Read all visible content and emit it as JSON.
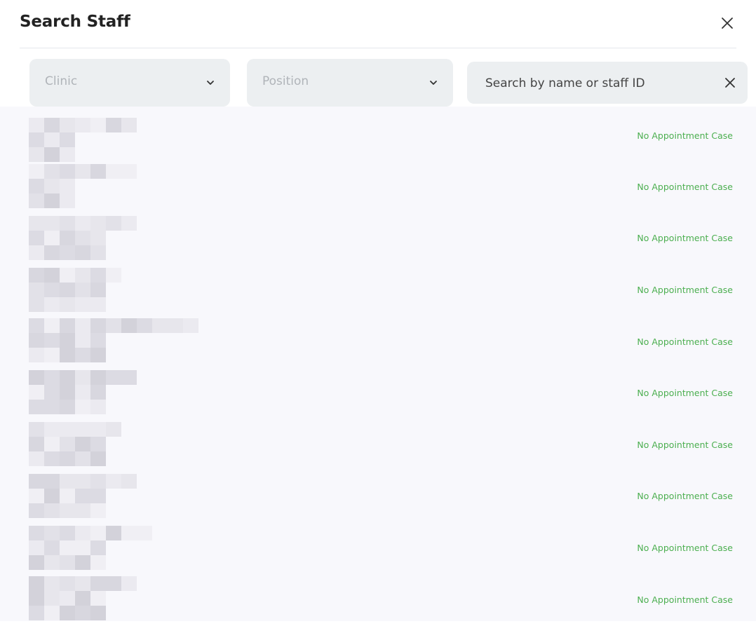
{
  "header": {
    "title": "Search Staff",
    "close_icon": "close-icon"
  },
  "filters": {
    "clinic_placeholder": "Clinic",
    "position_placeholder": "Position",
    "search_placeholder": "Search by name or staff ID",
    "search_value": ""
  },
  "colors": {
    "status_green": "#4caf50",
    "field_bg": "#eceff1",
    "list_bg": "#f8f8fc"
  },
  "staff": [
    {
      "status": "No Appointment Case"
    },
    {
      "status": "No Appointment Case"
    },
    {
      "status": "No Appointment Case"
    },
    {
      "status": "No Appointment Case"
    },
    {
      "status": "No Appointment Case"
    },
    {
      "status": "No Appointment Case"
    },
    {
      "status": "No Appointment Case"
    },
    {
      "status": "No Appointment Case"
    },
    {
      "status": "No Appointment Case"
    },
    {
      "status": "No Appointment Case"
    }
  ]
}
